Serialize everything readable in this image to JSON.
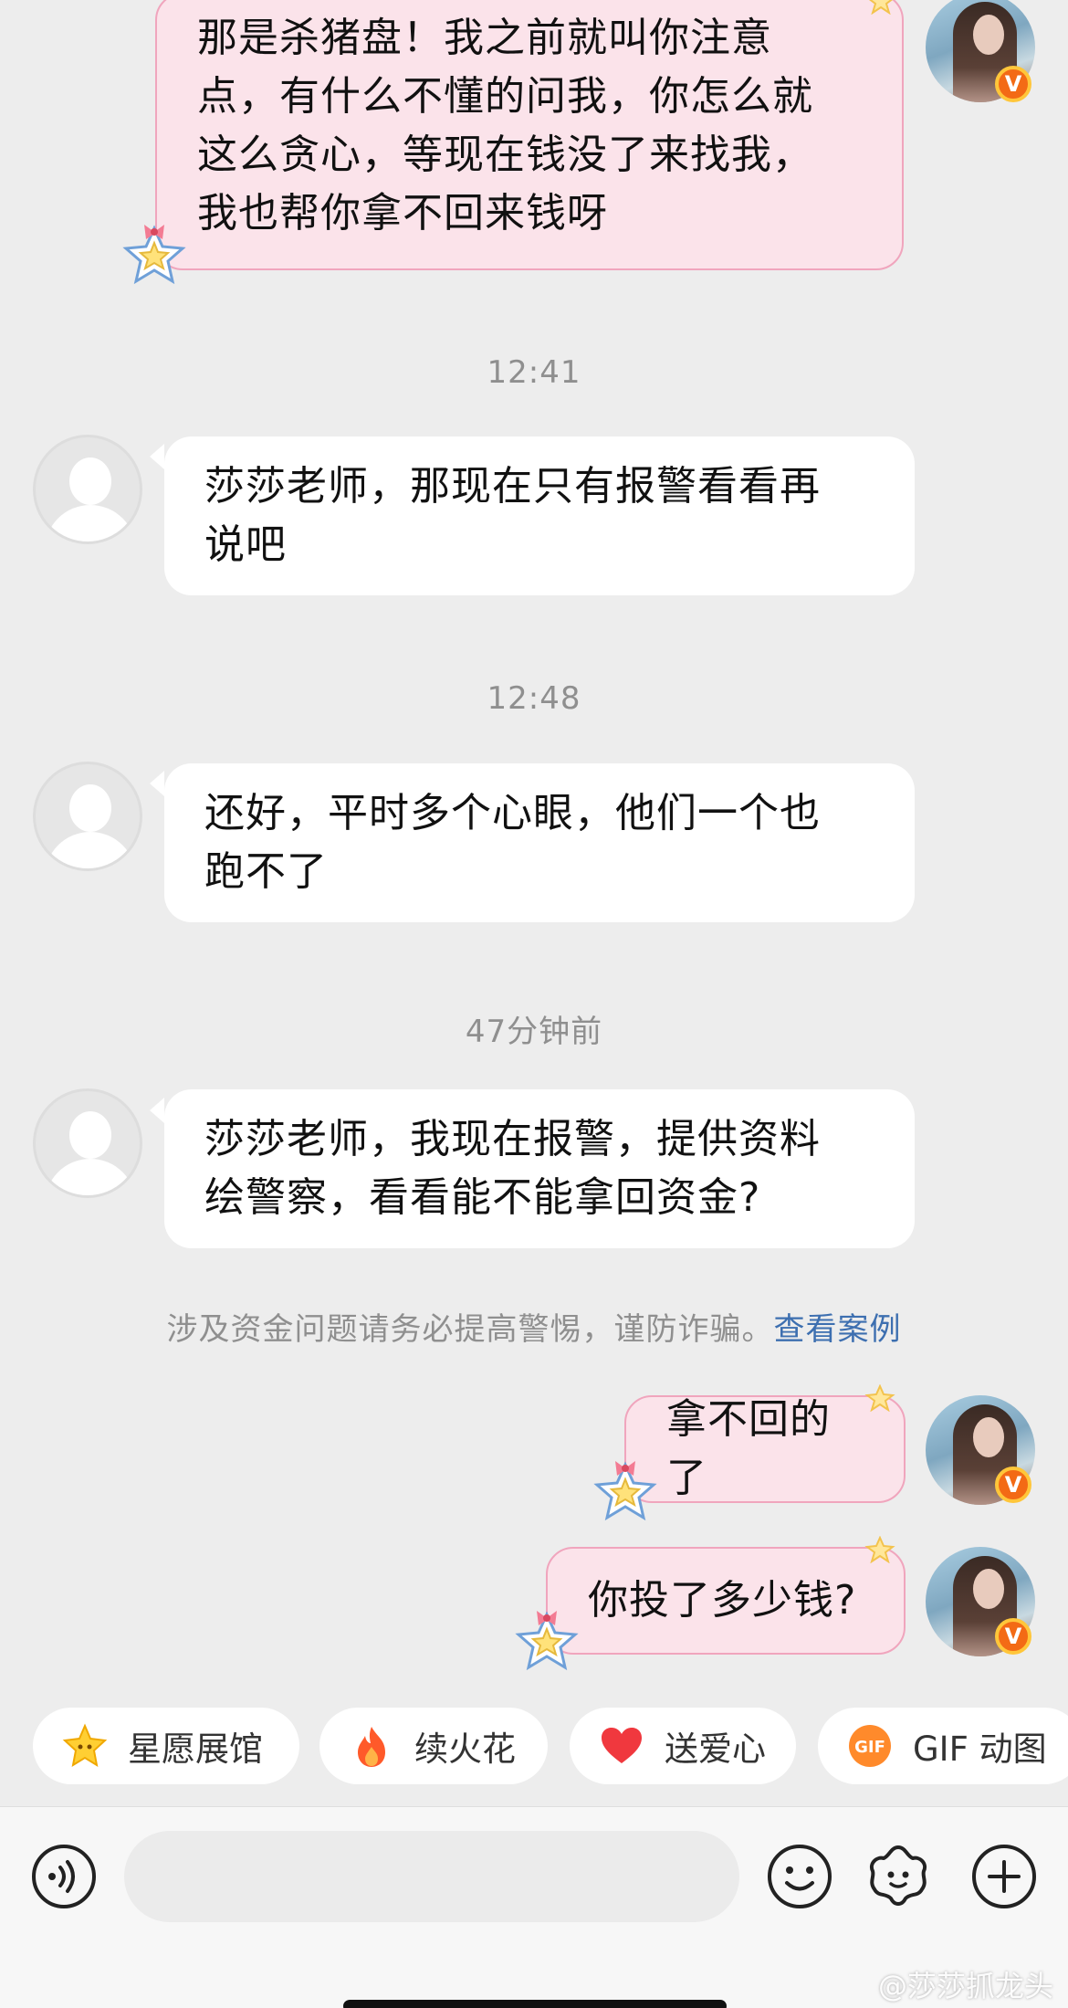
{
  "messages": [
    {
      "side": "me",
      "text": "那是杀猪盘！我之前就叫你注意\n点，有什么不懂的问我，你怎么就\n这么贪心，等现在钱没了来找我，\n我也帮你拿不回来钱呀"
    },
    {
      "side": "time",
      "text": "12:41"
    },
    {
      "side": "them",
      "text": "莎莎老师，那现在只有报警看看再\n说吧"
    },
    {
      "side": "time",
      "text": "12:48"
    },
    {
      "side": "them",
      "text": "还好，平时多个心眼，他们一个也\n跑不了"
    },
    {
      "side": "time",
      "text": "47分钟前"
    },
    {
      "side": "them",
      "text": "莎莎老师，我现在报警，提供资料\n绘警察，看看能不能拿回资金?"
    },
    {
      "side": "notice",
      "text": "涉及资金问题请务必提高警惕，谨防诈骗。",
      "link": "查看案例"
    },
    {
      "side": "me",
      "text": "拿不回的了"
    },
    {
      "side": "me",
      "text": "你投了多少钱?"
    }
  ],
  "verified_badge": "V",
  "quick_actions": [
    {
      "label": "星愿展馆",
      "icon": "star-icon"
    },
    {
      "label": "续火花",
      "icon": "fire-icon"
    },
    {
      "label": "送爱心",
      "icon": "heart-icon"
    },
    {
      "label": "GIF 动图",
      "icon": "gif-icon",
      "icon_text": "GIF"
    }
  ],
  "input": {
    "placeholder": ""
  },
  "toolbar_icons": [
    "voice-icon",
    "emoji-icon",
    "sticker-flower-icon",
    "plus-icon"
  ],
  "watermark": "@莎莎抓龙头",
  "colors": {
    "background": "#ededed",
    "my_bubble": "#fbe3ea",
    "my_bubble_border": "#f0a5bd",
    "their_bubble": "#ffffff",
    "link": "#3d6fb0",
    "badge": "#f36a15"
  }
}
